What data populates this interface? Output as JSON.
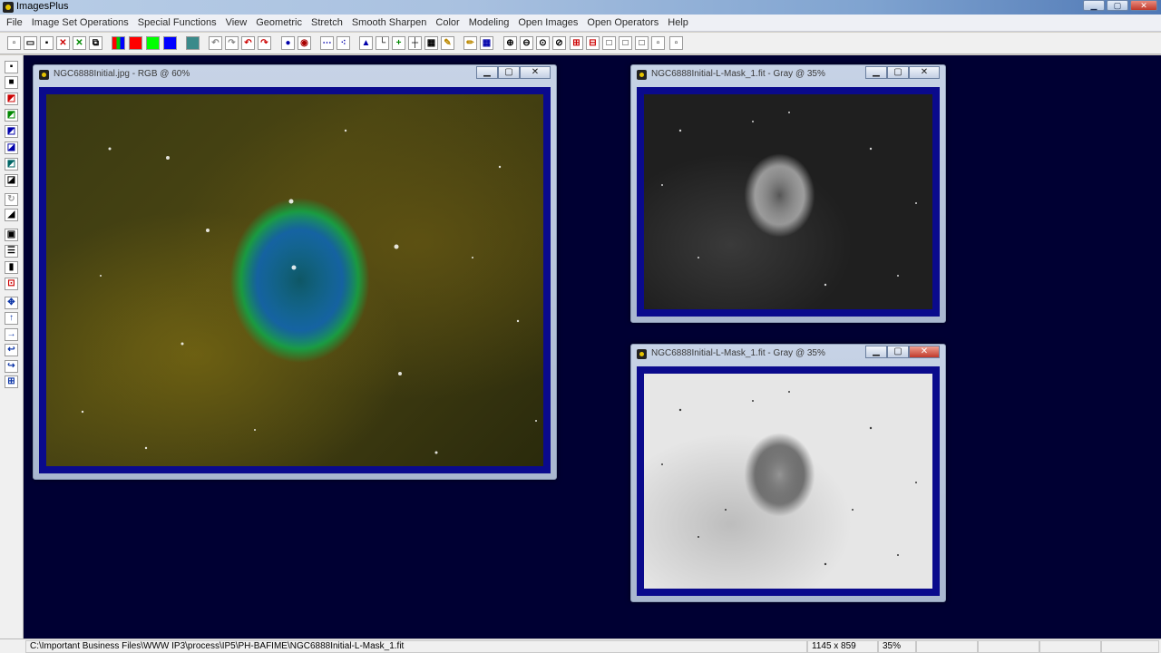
{
  "app": {
    "title": "ImagesPlus"
  },
  "menu": [
    "File",
    "Image Set Operations",
    "Special Functions",
    "View",
    "Geometric",
    "Stretch",
    "Smooth Sharpen",
    "Color",
    "Modeling",
    "Open Images",
    "Open Operators",
    "Help"
  ],
  "windows": {
    "main": {
      "caption": "NGC6888Initial.jpg - RGB @ 60%"
    },
    "mask": {
      "caption": "NGC6888Initial-L-Mask_1.fit - Gray @ 35%"
    },
    "mask_inverted": {
      "caption": "NGC6888Initial-L-Mask_1.fit - Gray @ 35%"
    }
  },
  "statusbar": {
    "path": "C:\\Important Business Files\\WWW IP3\\process\\IP5\\PH-BAFIME\\NGC6888Initial-L-Mask_1.fit",
    "dimensions": "1145 x 859",
    "zoom": "35%"
  },
  "colors": {
    "workspace": "#000033",
    "frame": "#0a0a8c"
  }
}
